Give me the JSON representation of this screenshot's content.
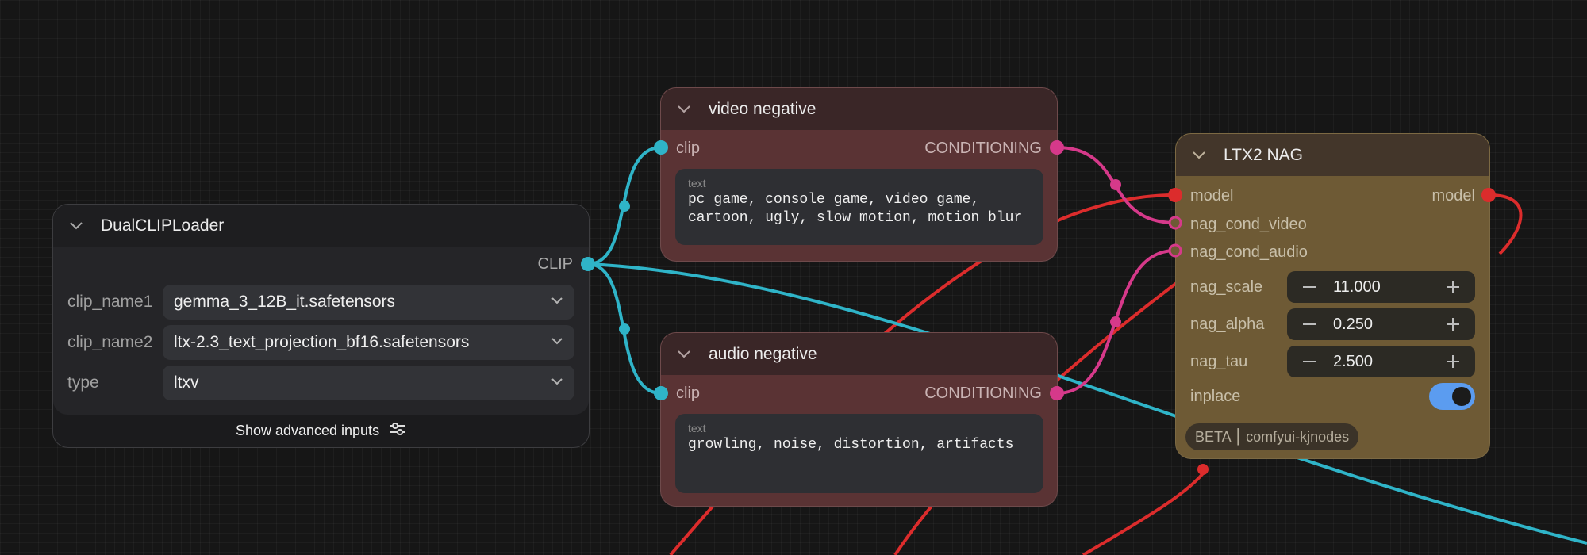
{
  "nodes": {
    "dualclip": {
      "title": "DualCLIPLoader",
      "output": "CLIP",
      "widgets": [
        {
          "label": "clip_name1",
          "value": "gemma_3_12B_it.safetensors"
        },
        {
          "label": "clip_name2",
          "value": "ltx-2.3_text_projection_bf16.safetensors"
        },
        {
          "label": "type",
          "value": "ltxv"
        }
      ],
      "advanced_label": "Show advanced inputs"
    },
    "video_negative": {
      "title": "video negative",
      "input": "clip",
      "output": "CONDITIONING",
      "text_label": "text",
      "text_value": "pc game, console game, video game,\ncartoon, ugly, slow motion, motion blur"
    },
    "audio_negative": {
      "title": "audio negative",
      "input": "clip",
      "output": "CONDITIONING",
      "text_label": "text",
      "text_value": "growling, noise, distortion, artifacts"
    },
    "ltx2nag": {
      "title": "LTX2 NAG",
      "inputs": [
        "model",
        "nag_cond_video",
        "nag_cond_audio"
      ],
      "output": "model",
      "numbers": [
        {
          "label": "nag_scale",
          "value": "11.000"
        },
        {
          "label": "nag_alpha",
          "value": "0.250"
        },
        {
          "label": "nag_tau",
          "value": "2.500"
        }
      ],
      "toggle_label": "inplace",
      "toggle_on": true,
      "badge": "BETA ⎮ comfyui-kjnodes"
    }
  },
  "colors": {
    "clip_wire": "#2fb4c8",
    "conditioning_wire": "#d6398a",
    "model_wire": "#dc2c2c",
    "video_node_body": "#5a3334",
    "nag_node_body": "#6e5a35"
  }
}
